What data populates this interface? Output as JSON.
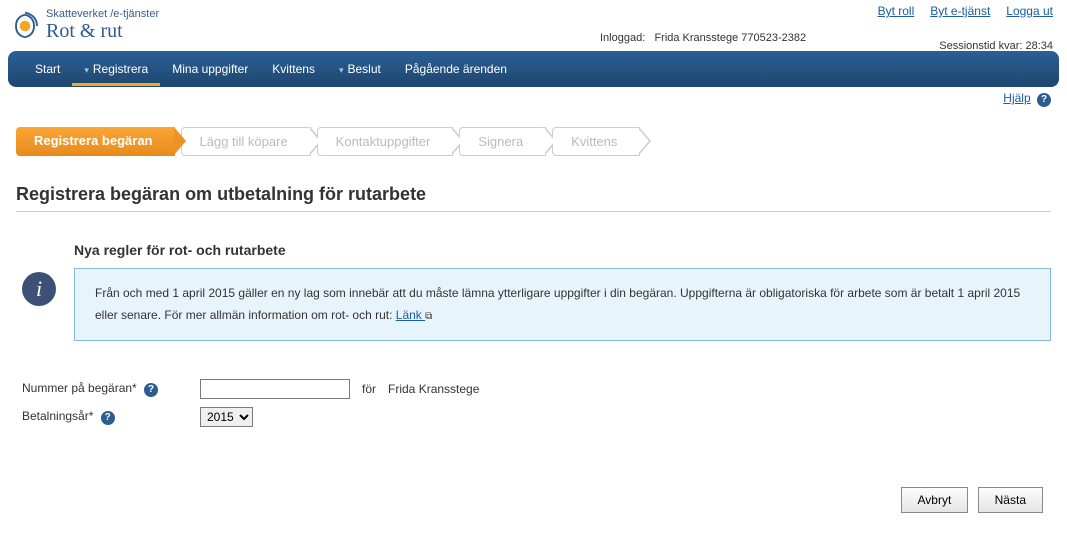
{
  "header": {
    "breadcrumb": "Skatteverket /e-tjänster",
    "title": "Rot & rut",
    "topLinks": {
      "role": "Byt roll",
      "service": "Byt e-tjänst",
      "logout": "Logga ut"
    },
    "loggedInLabel": "Inloggad:",
    "loggedInName": "Frida Kransstege 770523-2382",
    "session": "Sessionstid kvar: 28:34"
  },
  "nav": {
    "start": "Start",
    "register": "Registrera",
    "myData": "Mina uppgifter",
    "receipt": "Kvittens",
    "decision": "Beslut",
    "ongoing": "Pågående ärenden"
  },
  "help": {
    "label": "Hjälp"
  },
  "wizard": {
    "s1": "Registrera begäran",
    "s2": "Lägg till köpare",
    "s3": "Kontaktuppgifter",
    "s4": "Signera",
    "s5": "Kvittens"
  },
  "page": {
    "title": "Registrera begäran om utbetalning för rutarbete"
  },
  "info": {
    "heading": "Nya regler för rot- och rutarbete",
    "body": "Från och med 1 april 2015 gäller en ny lag som innebär att du måste lämna ytterligare uppgifter i din begäran. Uppgifterna är obligatoriska för arbete som är betalt 1 april 2015 eller senare. För mer allmän information om rot- och rut:  ",
    "linkText": "Länk "
  },
  "form": {
    "numberLabel": "Nummer på begäran*",
    "numberValue": "",
    "forLabel": "för",
    "forName": "Frida Kransstege",
    "yearLabel": "Betalningsår*",
    "yearValue": "2015"
  },
  "buttons": {
    "cancel": "Avbryt",
    "next": "Nästa"
  }
}
